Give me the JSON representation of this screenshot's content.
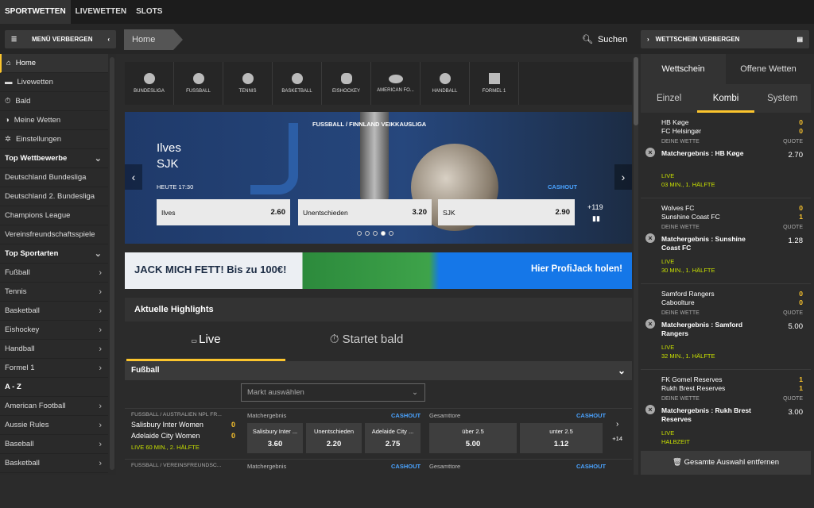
{
  "topnav": {
    "tabs": [
      "SPORTWETTEN",
      "LIVEWETTEN",
      "SLOTS"
    ]
  },
  "toolbar": {
    "menu_label": "MENÜ VERBERGEN",
    "breadcrumb": "Home",
    "search_label": "Suchen",
    "slip_label": "WETTSCHEIN VERBERGEN"
  },
  "sidebar": {
    "items": [
      "Home",
      "Livewetten",
      "Bald",
      "Meine Wetten",
      "Einstellungen",
      "Top Wettbewerbe",
      "Deutschland Bundesliga",
      "Deutschland 2. Bundesliga",
      "Champions League",
      "Vereinsfreundschaftsspiele",
      "Top Sportarten",
      "Fußball",
      "Tennis",
      "Basketball",
      "Eishockey",
      "Handball",
      "Formel 1",
      "A - Z",
      "American Football",
      "Aussie Rules",
      "Baseball",
      "Basketball"
    ]
  },
  "sports": [
    "BUNDESLIGA",
    "FUSSBALL",
    "TENNIS",
    "BASKETBALL",
    "EISHOCKEY",
    "AMERICAN FO...",
    "HANDBALL",
    "FORMEL 1"
  ],
  "hero": {
    "league": "FUSSBALL / FINNLAND VEIKKAUSLIGA",
    "team1": "Ilves",
    "team2": "SJK",
    "time": "HEUTE 17:30",
    "cashout": "CASHOUT",
    "odds": [
      {
        "label": "Ilves",
        "value": "2.60"
      },
      {
        "label": "Unentschieden",
        "value": "3.20"
      },
      {
        "label": "SJK",
        "value": "2.90"
      }
    ],
    "more": "+119"
  },
  "banner": {
    "left": "JACK MICH FETT! Bis zu 100€!",
    "right": "Hier ProfiJack holen!"
  },
  "highlights": {
    "title": "Aktuelle Highlights",
    "tab_live": "Live",
    "tab_soon": "Startet bald",
    "category": "Fußball",
    "market_placeholder": "Markt auswählen",
    "rows": [
      {
        "league": "FUSSBALL / AUSTRALIEN NPL FR...",
        "team1": "Salisbury Inter Women",
        "team2": "Adelaide City Women",
        "score1": "0",
        "score2": "0",
        "status": "LIVE 60 MIN., 2. HÄLFTE",
        "m1": "Matchergebnis",
        "c1": "CASHOUT",
        "o1": "Salisbury Inter ...",
        "v1": "3.60",
        "o2": "Unentschieden",
        "v2": "2.20",
        "o3": "Adelaide City ...",
        "v3": "2.75",
        "m2": "Gesamttore",
        "c2": "CASHOUT",
        "o4": "über 2.5",
        "v4": "5.00",
        "o5": "unter 2.5",
        "v5": "1.12",
        "more": "+14"
      },
      {
        "league": "FUSSBALL / VEREINSFREUNDSC...",
        "m1": "Matchergebnis",
        "c1": "CASHOUT",
        "m2": "Gesamttore",
        "c2": "CASHOUT"
      }
    ]
  },
  "slip": {
    "tab1": "Wettschein",
    "tab2": "Offene Wetten",
    "sub": [
      "Einzel",
      "Kombi",
      "System"
    ],
    "your_bet": "DEINE WETTE",
    "quote": "QUOTE",
    "bets": [
      {
        "team1": "HB Køge",
        "team2": "FC Helsingør",
        "s1": "0",
        "s2": "0",
        "market": "Matchergebnis : HB Køge",
        "odd": "2.70",
        "live": "LIVE",
        "min": "03 MIN., 1. HÄLFTE"
      },
      {
        "team1": "Wolves FC",
        "team2": "Sunshine Coast FC",
        "s1": "0",
        "s2": "1",
        "market": "Matchergebnis : Sunshine Coast FC",
        "odd": "1.28",
        "live": "LIVE",
        "min": "30 MIN., 1. HÄLFTE"
      },
      {
        "team1": "Samford Rangers",
        "team2": "Caboolture",
        "s1": "0",
        "s2": "0",
        "market": "Matchergebnis : Samford Rangers",
        "odd": "5.00",
        "live": "LIVE",
        "min": "32 MIN., 1. HÄLFTE"
      },
      {
        "team1": "FK Gomel Reserves",
        "team2": "Rukh Brest Reserves",
        "s1": "1",
        "s2": "1",
        "market": "Matchergebnis : Rukh Brest Reserves",
        "odd": "3.00",
        "live": "LIVE",
        "min": "HALBZEIT"
      }
    ],
    "remove_all": "Gesamte Auswahl entfernen"
  },
  "colors": {
    "accent": "#fcc52d",
    "live": "#c8e000",
    "cashout": "#4aa3ff"
  }
}
